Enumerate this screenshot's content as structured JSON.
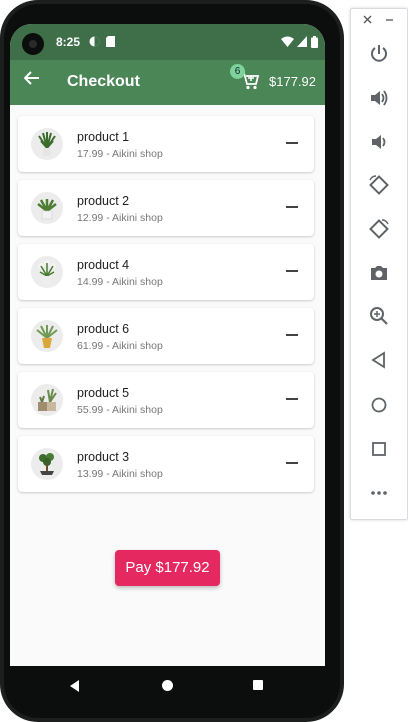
{
  "status_bar": {
    "time": "8:25"
  },
  "app_bar": {
    "title": "Checkout",
    "cart_count": "6",
    "total": "$177.92"
  },
  "products": [
    {
      "name": "product 1",
      "subtitle": "17.99 - Aikini shop"
    },
    {
      "name": "product 2",
      "subtitle": "12.99 - Aikini shop"
    },
    {
      "name": "product 4",
      "subtitle": "14.99 - Aikini shop"
    },
    {
      "name": "product 6",
      "subtitle": "61.99 - Aikini shop"
    },
    {
      "name": "product 5",
      "subtitle": "55.99 - Aikini shop"
    },
    {
      "name": "product 3",
      "subtitle": "13.99 - Aikini shop"
    }
  ],
  "pay_button": {
    "label": "Pay $177.92"
  },
  "colors": {
    "status_bar": "#3f6f49",
    "app_bar": "#4a8656",
    "badge": "#7ed39a",
    "pay_button": "#e5285f"
  },
  "emulator_panel": {
    "buttons": [
      "close-icon",
      "minimize-icon",
      "power-icon",
      "volume-up-icon",
      "volume-down-icon",
      "rotate-left-icon",
      "rotate-right-icon",
      "camera-icon",
      "zoom-icon",
      "back-icon",
      "home-icon",
      "overview-icon",
      "more-icon"
    ]
  }
}
